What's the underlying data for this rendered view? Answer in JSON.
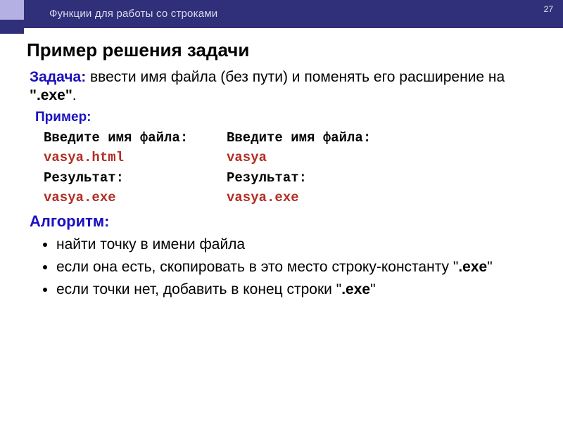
{
  "page_number": "27",
  "header": "Функции для работы со строками",
  "title": "Пример решения задачи",
  "task": {
    "label": "Задача:",
    "text_1": " ввести имя файла (без пути) и поменять его расширение на ",
    "ext_bold": "\".exe\"",
    "text_2": "."
  },
  "example_label": "Пример:",
  "examples": {
    "left": {
      "prompt": "Введите имя файла:",
      "input": "vasya.html",
      "result_label": "Результат:",
      "result": "vasya.exe"
    },
    "right": {
      "prompt": "Введите имя файла:",
      "input": "vasya",
      "result_label": "Результат:",
      "result": "vasya.exe"
    }
  },
  "algorithm": {
    "label": "Алгоритм:",
    "items": [
      {
        "text": "найти точку в имени файла"
      },
      {
        "pre": "если она есть, скопировать в это место строку-константу \"",
        "bold": ".exe",
        "post": "\""
      },
      {
        "pre": "если точки нет, добавить в конец строки \"",
        "bold": ".exe",
        "post": "\""
      }
    ]
  }
}
